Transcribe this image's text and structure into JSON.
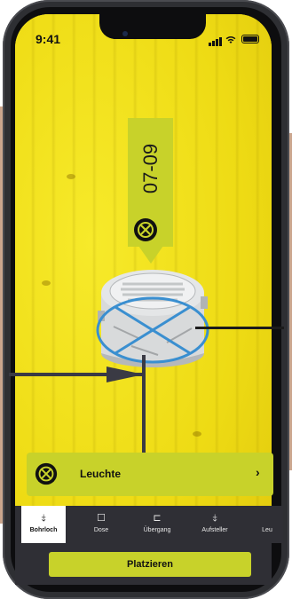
{
  "status_bar": {
    "time": "9:41"
  },
  "marker": {
    "code": "07-09",
    "icon": "x-circle-icon"
  },
  "selected_item": {
    "label": "Leuchte",
    "icon": "x-circle-icon",
    "chevron": "›"
  },
  "tabs": [
    {
      "label": "Bohrloch",
      "icon": "drill-icon",
      "glyph": "⤈",
      "active": true
    },
    {
      "label": "Dose",
      "icon": "box-icon",
      "glyph": "☐",
      "active": false
    },
    {
      "label": "Übergang",
      "icon": "transition-icon",
      "glyph": "⊏",
      "active": false
    },
    {
      "label": "Aufsteller",
      "icon": "riser-icon",
      "glyph": "⤈",
      "active": false
    },
    {
      "label": "Leu",
      "icon": "light-icon",
      "glyph": "",
      "active": false
    }
  ],
  "primary_action": {
    "label": "Platzieren"
  },
  "colors": {
    "accent": "#c8d22a",
    "background": "#f2e31a",
    "tabbar": "#2f2f35",
    "selection_ring": "#3a8fd0"
  }
}
